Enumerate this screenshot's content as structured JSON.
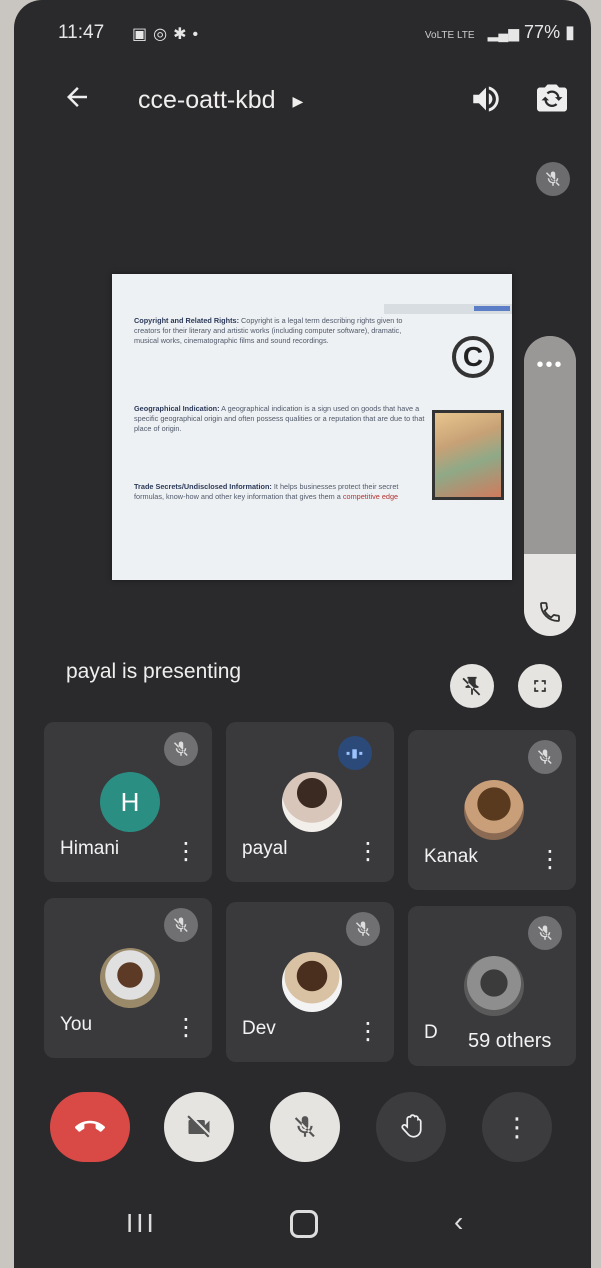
{
  "status_bar": {
    "time": "11:47",
    "network_text": "VoLTE LTE",
    "battery": "77%"
  },
  "header": {
    "meeting_code": "cce-oatt-kbd"
  },
  "presentation": {
    "slide": {
      "p1_title": "Copyright and Related Rights:",
      "p1_text": "Copyright is a legal term describing rights given to creators for their literary and artistic works (including computer software), dramatic, musical works, cinematographic films and sound recordings.",
      "p2_title": "Geographical Indication:",
      "p2_text": "A geographical indication is a sign used on goods that have a specific geographical origin and often possess qualities or a reputation that are due to that place of origin.",
      "p3_title": "Trade Secrets/Undisclosed Information:",
      "p3_text": "It helps businesses protect their secret formulas, know-how and other key information that gives them a",
      "p3_highlight": "competitive edge",
      "copyright_symbol": "C"
    },
    "presenting_text": "payal is presenting",
    "panel_dots": "•••"
  },
  "participants": [
    {
      "name": "Himani",
      "avatar": "H"
    },
    {
      "name": "payal"
    },
    {
      "name": "Kanak"
    },
    {
      "name": "You"
    },
    {
      "name": "Dev"
    },
    {
      "name": "D"
    }
  ],
  "others_label": "59 others",
  "controls": {
    "more": "⋮"
  },
  "nav": {
    "recent": "III"
  },
  "colors": {
    "end_call": "#d94a47",
    "speaking": "#2b4a7a",
    "avatar_h": "#2b8e83"
  }
}
